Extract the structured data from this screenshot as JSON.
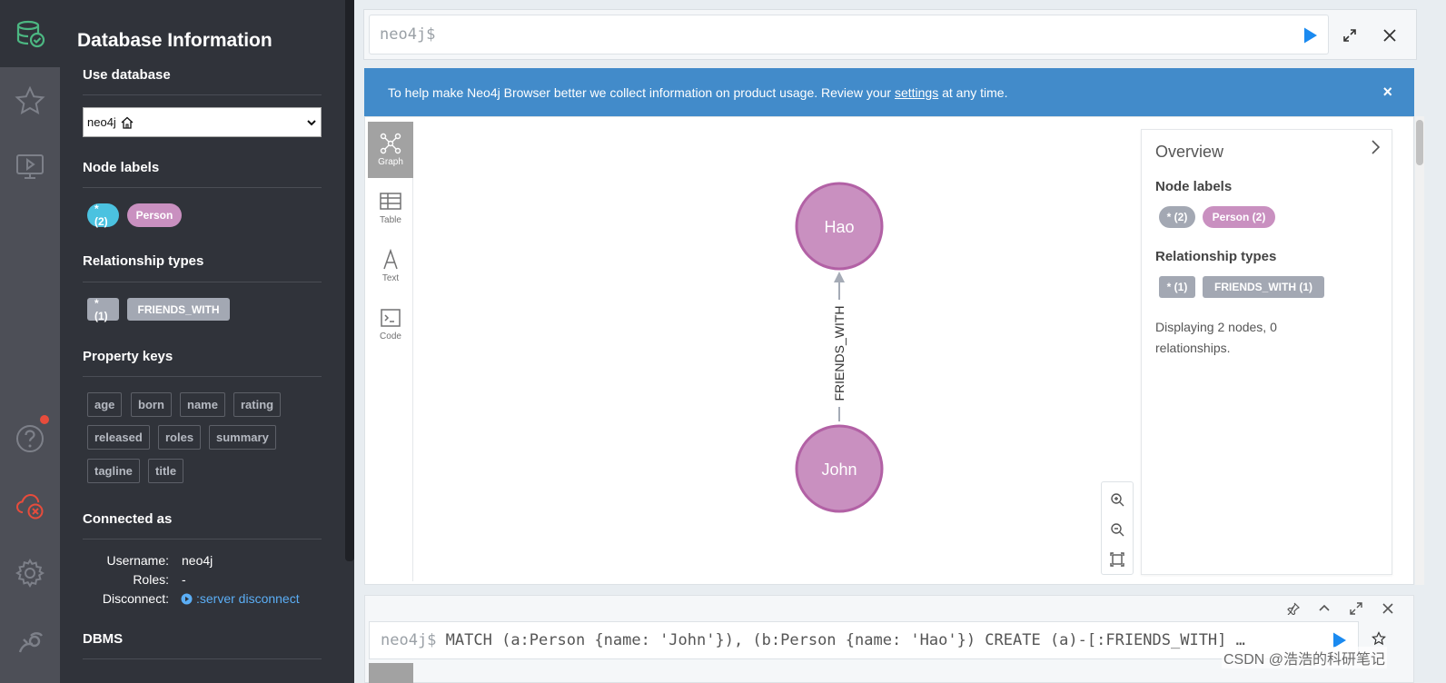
{
  "drawer": {
    "title": "Database Information",
    "use_database": {
      "heading": "Use database",
      "selected": "neo4j"
    },
    "node_labels": {
      "heading": "Node labels",
      "items": [
        "*(2)",
        "Person"
      ]
    },
    "relationship_types": {
      "heading": "Relationship types",
      "items": [
        "*(1)",
        "FRIENDS_WITH"
      ]
    },
    "property_keys": {
      "heading": "Property keys",
      "items": [
        "age",
        "born",
        "name",
        "rating",
        "released",
        "roles",
        "summary",
        "tagline",
        "title"
      ]
    },
    "connected_as": {
      "heading": "Connected as",
      "username_label": "Username:",
      "username": "neo4j",
      "roles_label": "Roles:",
      "roles": "-",
      "disconnect_label": "Disconnect:",
      "disconnect_command": ":server disconnect"
    },
    "dbms_heading": "DBMS"
  },
  "editor": {
    "prompt": "neo4j$"
  },
  "banner": {
    "text_before": "To help make Neo4j Browser better we collect information on product usage. Review your ",
    "link_text": "settings",
    "text_after": " at any time.",
    "close": "×"
  },
  "result_frame": {
    "view_tabs": [
      "Graph",
      "Table",
      "Text",
      "Code"
    ],
    "graph": {
      "nodes": [
        "Hao",
        "John"
      ],
      "relationship": "FRIENDS_WITH"
    },
    "overview": {
      "title": "Overview",
      "node_labels_heading": "Node labels",
      "node_labels": [
        "* (2)",
        "Person (2)"
      ],
      "relationship_types_heading": "Relationship types",
      "relationship_types": [
        "* (1)",
        "FRIENDS_WITH (1)"
      ],
      "status": "Displaying 2 nodes, 0 relationships."
    }
  },
  "query_frame": {
    "prompt": "neo4j$",
    "query": "MATCH (a:Person {name: 'John'}), (b:Person {name: 'Hao'}) CREATE (a)-[:FRIENDS_WITH] …"
  },
  "watermark": "CSDN @浩浩的科研笔记",
  "colors": {
    "rail": "#4d4f57",
    "drawer": "#30333a",
    "banner": "#428bca",
    "node_fill": "#c990c0",
    "node_stroke": "#b261a5",
    "all_label_pill": "#4bc2e0",
    "person_pill": "#c990c0",
    "rel_tag": "#a3a8b3",
    "accent_green": "#4cb782",
    "play_blue": "#1b8af0",
    "danger_red": "#e74c3c"
  },
  "icons": [
    "database-icon",
    "star-icon",
    "monitor-play-icon",
    "help-icon",
    "cloud-disconnect-icon",
    "gear-icon",
    "plug-icon",
    "play-icon",
    "expand-icon",
    "close-icon",
    "graph-icon",
    "table-icon",
    "text-icon",
    "code-icon",
    "zoom-in-icon",
    "zoom-out-icon",
    "fit-icon",
    "pin-icon",
    "collapse-icon",
    "star-outline-icon"
  ]
}
